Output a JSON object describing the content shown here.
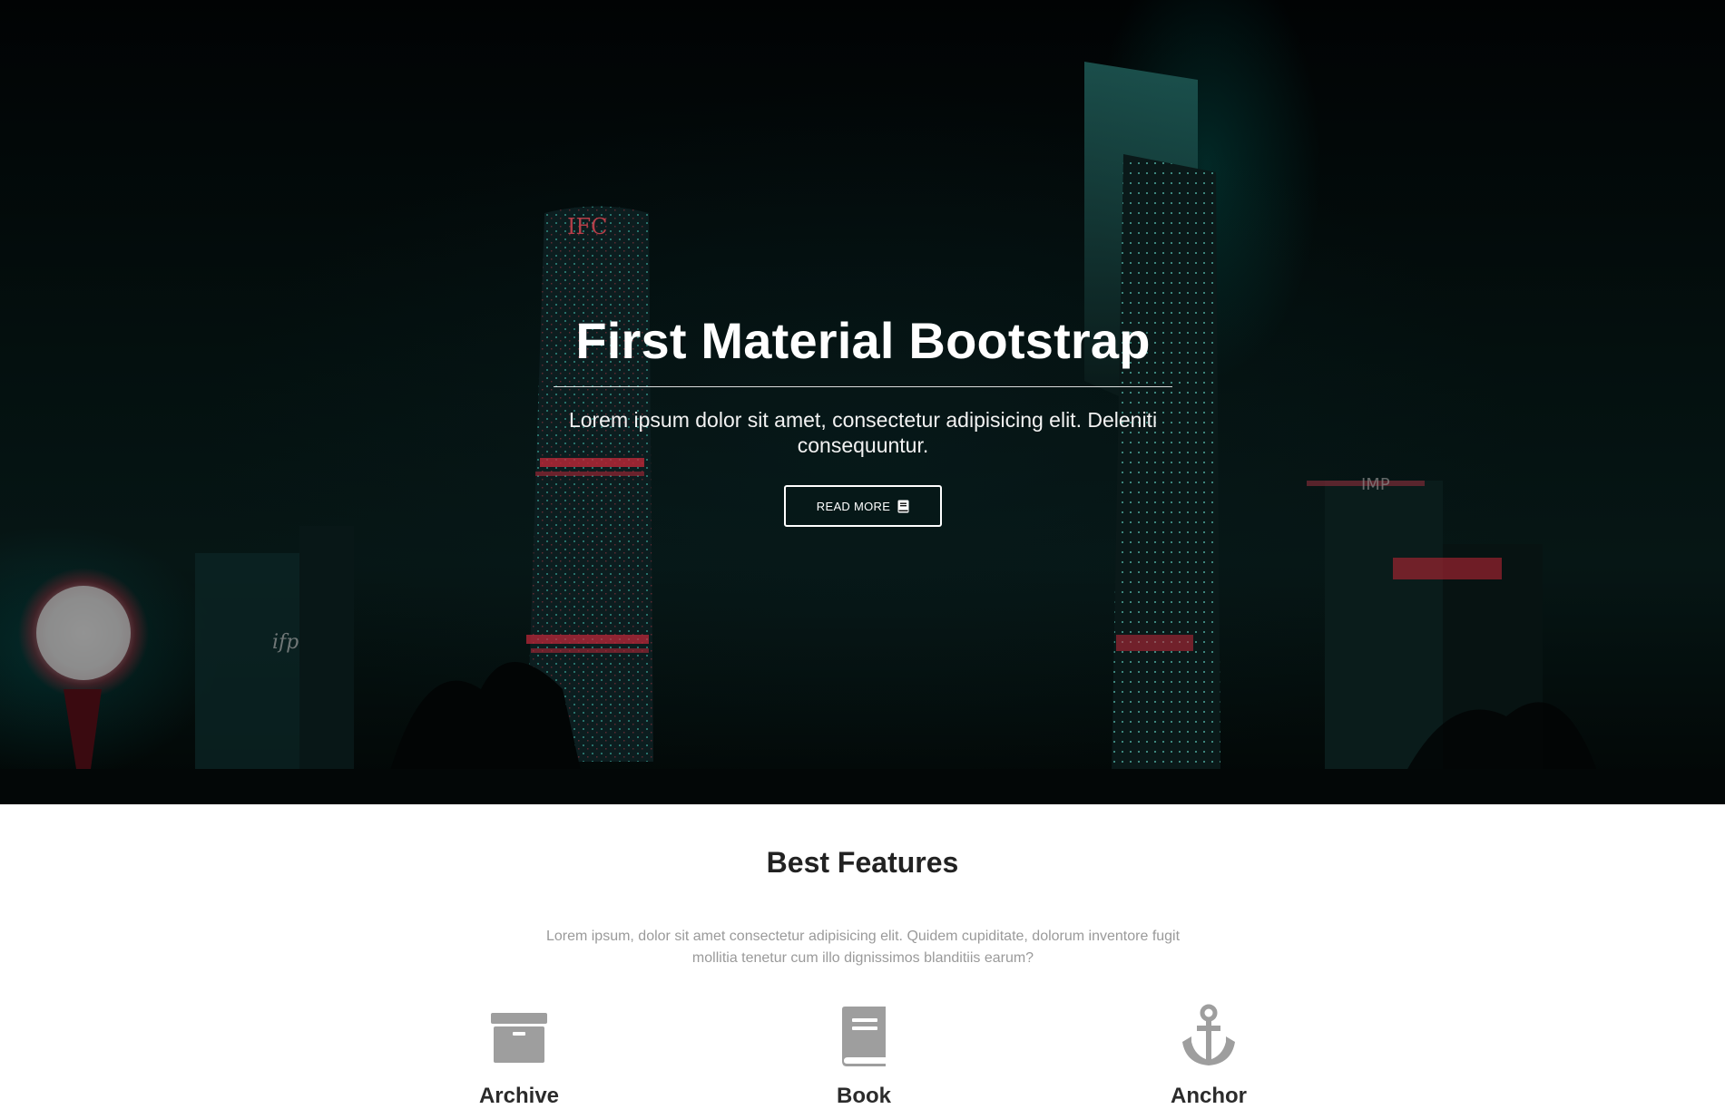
{
  "hero": {
    "title": "First Material Bootstrap",
    "subtitle": "Lorem ipsum dolor sit amet, consectetur adipisicing elit. Deleniti consequuntur.",
    "button_label": "READ MORE",
    "button_icon": "book-icon"
  },
  "features": {
    "title": "Best Features",
    "lead": "Lorem ipsum, dolor sit amet consectetur adipisicing elit. Quidem cupiditate, dolorum inventore fugit mollitia tenetur cum illo dignissimos blanditiis earum?",
    "items": [
      {
        "label": "Archive",
        "icon": "archive-icon"
      },
      {
        "label": "Book",
        "icon": "book-icon"
      },
      {
        "label": "Anchor",
        "icon": "anchor-icon"
      }
    ],
    "icon_color": "#9e9e9e"
  },
  "colors": {
    "hero_text": "#ffffff",
    "feature_title": "#222222",
    "lead_text": "#9a9a9a"
  }
}
